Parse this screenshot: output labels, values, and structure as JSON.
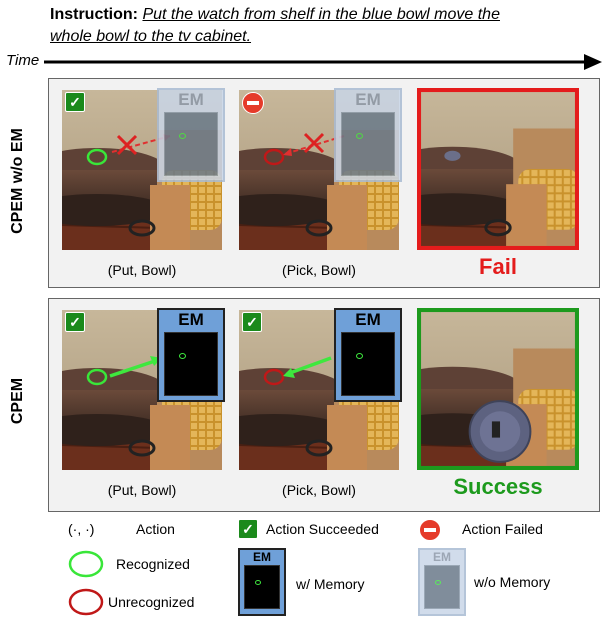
{
  "instruction": {
    "label": "Instruction:",
    "text_line1": "Put the watch from shelf in the blue bowl move the",
    "text_line2": "whole bowl to the tv cabinet."
  },
  "time_label": "Time",
  "rows": [
    {
      "label": "CPEM w/o EM",
      "steps": [
        {
          "caption": "(Put, Bowl)",
          "status": "Action Succeeded",
          "em": "EM"
        },
        {
          "caption": "(Pick, Bowl)",
          "status": "Action Failed",
          "em": "EM"
        }
      ],
      "result": "Fail",
      "result_color": "#e41c1c"
    },
    {
      "label": "CPEM",
      "steps": [
        {
          "caption": "(Put, Bowl)",
          "status": "Action Succeeded",
          "em": "EM"
        },
        {
          "caption": "(Pick, Bowl)",
          "status": "Action Succeeded",
          "em": "EM"
        }
      ],
      "result": "Success",
      "result_color": "#1d9a1d"
    }
  ],
  "legend": {
    "action_symbol": "(·, ·)",
    "action": "Action",
    "succeeded": "Action Succeeded",
    "failed": "Action Failed",
    "recognized": "Recognized",
    "unrecognized": "Unrecognized",
    "em_label": "EM",
    "with_memory": "w/ Memory",
    "without_memory": "w/o Memory",
    "colors": {
      "recognized": "#39e639",
      "unrecognized": "#c01818",
      "arrow_green": "#3ee83e",
      "arrow_red": "#e03030"
    }
  }
}
